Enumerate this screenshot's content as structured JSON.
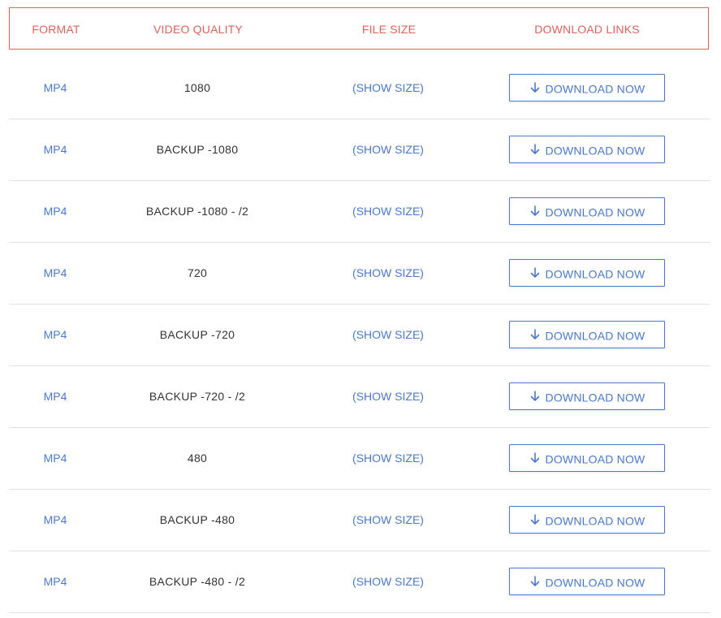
{
  "header": {
    "format": "FORMAT",
    "video_quality": "VIDEO QUALITY",
    "file_size": "FILE SIZE",
    "download_links": "DOWNLOAD LINKS"
  },
  "rows": [
    {
      "format": "MP4",
      "quality": "1080",
      "size": "(SHOW SIZE)",
      "button": "DOWNLOAD NOW"
    },
    {
      "format": "MP4",
      "quality": "BACKUP -1080",
      "size": "(SHOW SIZE)",
      "button": "DOWNLOAD NOW"
    },
    {
      "format": "MP4",
      "quality": "BACKUP -1080 - /2",
      "size": "(SHOW SIZE)",
      "button": "DOWNLOAD NOW"
    },
    {
      "format": "MP4",
      "quality": "720",
      "size": "(SHOW SIZE)",
      "button": "DOWNLOAD NOW"
    },
    {
      "format": "MP4",
      "quality": "BACKUP -720",
      "size": "(SHOW SIZE)",
      "button": "DOWNLOAD NOW"
    },
    {
      "format": "MP4",
      "quality": "BACKUP -720 - /2",
      "size": "(SHOW SIZE)",
      "button": "DOWNLOAD NOW"
    },
    {
      "format": "MP4",
      "quality": "480",
      "size": "(SHOW SIZE)",
      "button": "DOWNLOAD NOW"
    },
    {
      "format": "MP4",
      "quality": "BACKUP -480",
      "size": "(SHOW SIZE)",
      "button": "DOWNLOAD NOW"
    },
    {
      "format": "MP4",
      "quality": "BACKUP -480 - /2",
      "size": "(SHOW SIZE)",
      "button": "DOWNLOAD NOW"
    }
  ],
  "colors": {
    "header_accent": "#e0605c",
    "link_blue": "#4a78cf",
    "text_dark": "#333333",
    "divider": "#e2e2e2"
  },
  "icons": {
    "download": "arrow-down-icon"
  }
}
